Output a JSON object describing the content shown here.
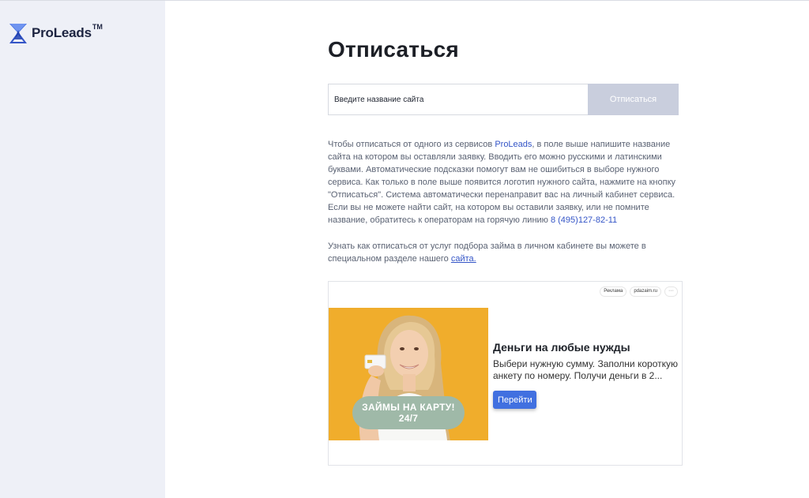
{
  "brand": {
    "name": "ProLeads",
    "tm": "TM"
  },
  "page": {
    "title": "Отписаться"
  },
  "search": {
    "placeholder": "Введите название сайта",
    "button_label": "Отписаться"
  },
  "description": {
    "part1": "Чтобы отписаться от одного из сервисов ",
    "brand_link": "ProLeads",
    "part2": ", в поле выше напишите название сайта на котором вы оставляли заявку. Вводить его можно русскими и латинскими буквами. Автоматические подсказки помогут вам не ошибиться в выборе нужного сервиса. Как только в поле выше появится логотип нужного сайта, нажмите на кнопку \"Отписаться\". Система автоматически перенаправит вас на личный кабинет сервиса. Если вы не можете найти сайт, на котором вы оставили заявку, или не помните название, обратитесь к операторам на горячую линию ",
    "phone": "8 (495)127-82-11"
  },
  "loan_info": {
    "text": "Узнать как отписаться от услуг подбора займа в личном кабинете вы можете в специальном разделе нашего ",
    "link": "сайта."
  },
  "ad": {
    "label": "Реклама",
    "domain": "pdazaim.ru",
    "menu": "···",
    "badge_line1": "ЗАЙМЫ НА КАРТУ!",
    "badge_line2": "24/7",
    "headline": "Деньги на любые нужды",
    "text": "Выбери нужную сумму. Заполни короткую анкету по номеру. Получи деньги в 2...",
    "button": "Перейти"
  },
  "colors": {
    "accent": "#3455c7",
    "sidebar_bg": "#eef0f7",
    "button_disabled": "#c9cedd",
    "ad_button": "#4170e0"
  }
}
